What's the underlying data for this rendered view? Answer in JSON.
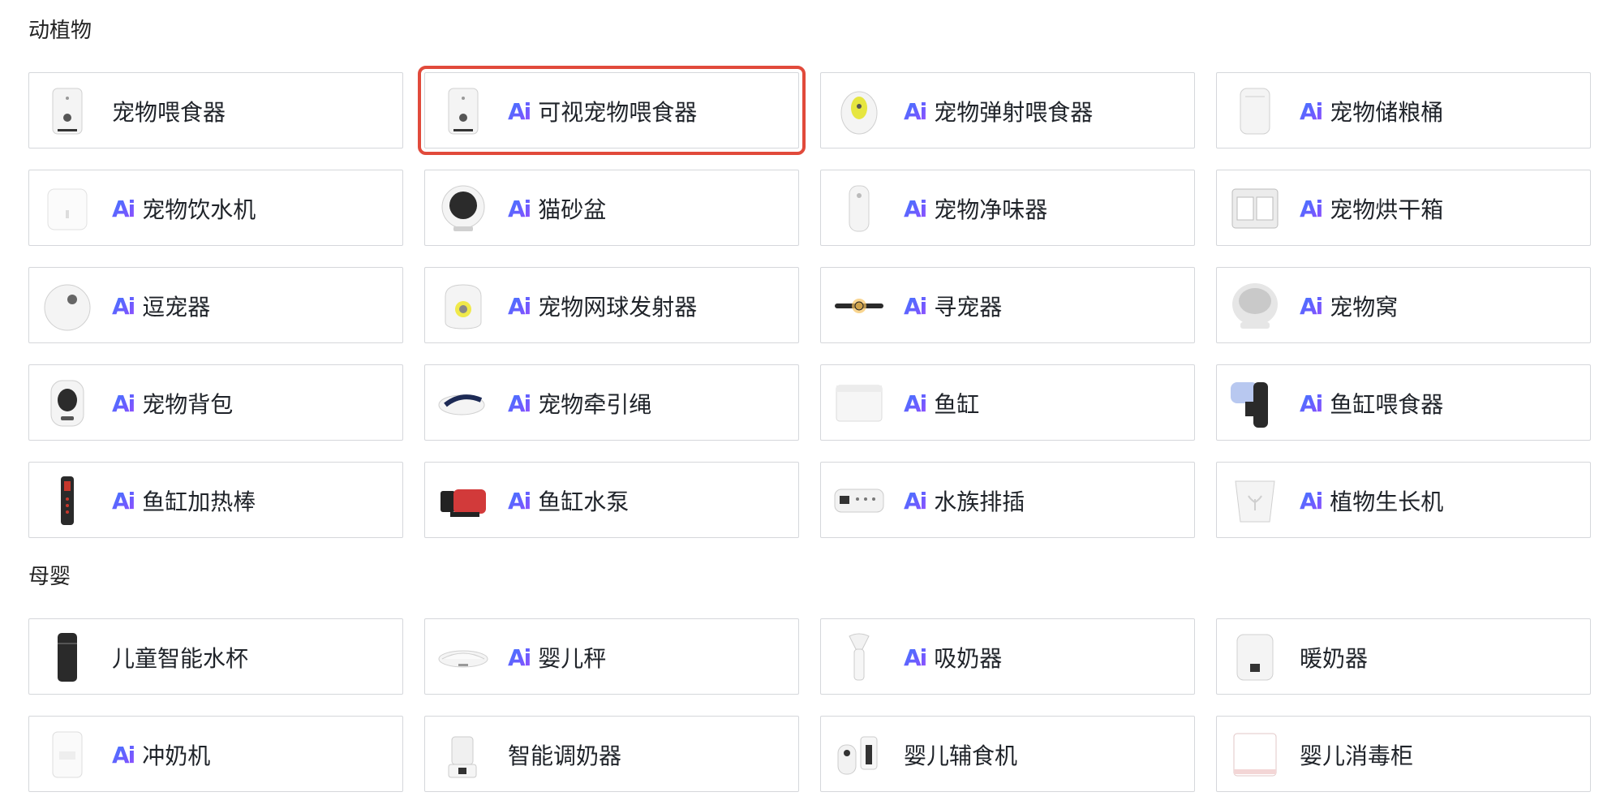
{
  "sections": [
    {
      "title": "动植物",
      "items": [
        {
          "label": "宠物喂食器",
          "ai": false,
          "icon": "pet-feeder-icon"
        },
        {
          "label": "可视宠物喂食器",
          "ai": true,
          "icon": "camera-pet-feeder-icon",
          "selected": true
        },
        {
          "label": "宠物弹射喂食器",
          "ai": true,
          "icon": "treat-launcher-icon"
        },
        {
          "label": "宠物储粮桶",
          "ai": true,
          "icon": "food-storage-bin-icon"
        },
        {
          "label": "宠物饮水机",
          "ai": true,
          "icon": "pet-water-fountain-icon"
        },
        {
          "label": "猫砂盆",
          "ai": true,
          "icon": "litter-box-icon"
        },
        {
          "label": "宠物净味器",
          "ai": true,
          "icon": "odor-purifier-icon"
        },
        {
          "label": "宠物烘干箱",
          "ai": true,
          "icon": "pet-dryer-box-icon"
        },
        {
          "label": "逗宠器",
          "ai": true,
          "icon": "pet-toy-ball-icon"
        },
        {
          "label": "宠物网球发射器",
          "ai": true,
          "icon": "tennis-launcher-icon"
        },
        {
          "label": "寻宠器",
          "ai": true,
          "icon": "pet-tracker-icon"
        },
        {
          "label": "宠物窝",
          "ai": true,
          "icon": "pet-bed-icon"
        },
        {
          "label": "宠物背包",
          "ai": true,
          "icon": "pet-backpack-icon"
        },
        {
          "label": "宠物牵引绳",
          "ai": true,
          "icon": "pet-leash-icon"
        },
        {
          "label": "鱼缸",
          "ai": true,
          "icon": "fish-tank-icon"
        },
        {
          "label": "鱼缸喂食器",
          "ai": true,
          "icon": "aquarium-feeder-icon"
        },
        {
          "label": "鱼缸加热棒",
          "ai": true,
          "icon": "aquarium-heater-icon"
        },
        {
          "label": "鱼缸水泵",
          "ai": true,
          "icon": "aquarium-pump-icon"
        },
        {
          "label": "水族排插",
          "ai": true,
          "icon": "aquarium-power-strip-icon"
        },
        {
          "label": "植物生长机",
          "ai": true,
          "icon": "plant-grower-icon"
        }
      ]
    },
    {
      "title": "母婴",
      "items": [
        {
          "label": "儿童智能水杯",
          "ai": false,
          "icon": "kids-smart-cup-icon"
        },
        {
          "label": "婴儿秤",
          "ai": true,
          "icon": "baby-scale-icon"
        },
        {
          "label": "吸奶器",
          "ai": true,
          "icon": "breast-pump-icon"
        },
        {
          "label": "暖奶器",
          "ai": false,
          "icon": "bottle-warmer-icon"
        },
        {
          "label": "冲奶机",
          "ai": true,
          "icon": "formula-maker-icon"
        },
        {
          "label": "智能调奶器",
          "ai": false,
          "icon": "smart-kettle-icon"
        },
        {
          "label": "婴儿辅食机",
          "ai": false,
          "icon": "baby-food-maker-icon"
        },
        {
          "label": "婴儿消毒柜",
          "ai": false,
          "icon": "sterilizer-cabinet-icon"
        }
      ]
    }
  ],
  "ai_badge": "Ai",
  "colors": {
    "selected_outline": "#e14a3b",
    "card_border": "#d5d7db",
    "ai_gradient_start": "#3b7cff",
    "ai_gradient_end": "#9a4dff"
  }
}
